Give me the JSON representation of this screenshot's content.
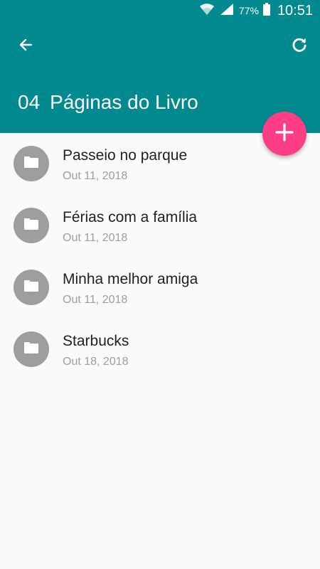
{
  "status_bar": {
    "battery": "77%",
    "time": "10:51"
  },
  "header": {
    "number": "04",
    "title": "Páginas do Livro"
  },
  "icons": {
    "back": "arrow-left-icon",
    "refresh": "refresh-icon",
    "add": "plus-icon",
    "folder": "folder-icon"
  },
  "colors": {
    "primary": "#008a90",
    "accent": "#ff3d87",
    "avatar": "#9e9e9e"
  },
  "items": [
    {
      "title": "Passeio no parque",
      "date": "Out 11, 2018"
    },
    {
      "title": "Férias com a família",
      "date": "Out 11, 2018"
    },
    {
      "title": "Minha melhor amiga",
      "date": "Out 11, 2018"
    },
    {
      "title": "Starbucks",
      "date": "Out 18, 2018"
    }
  ]
}
